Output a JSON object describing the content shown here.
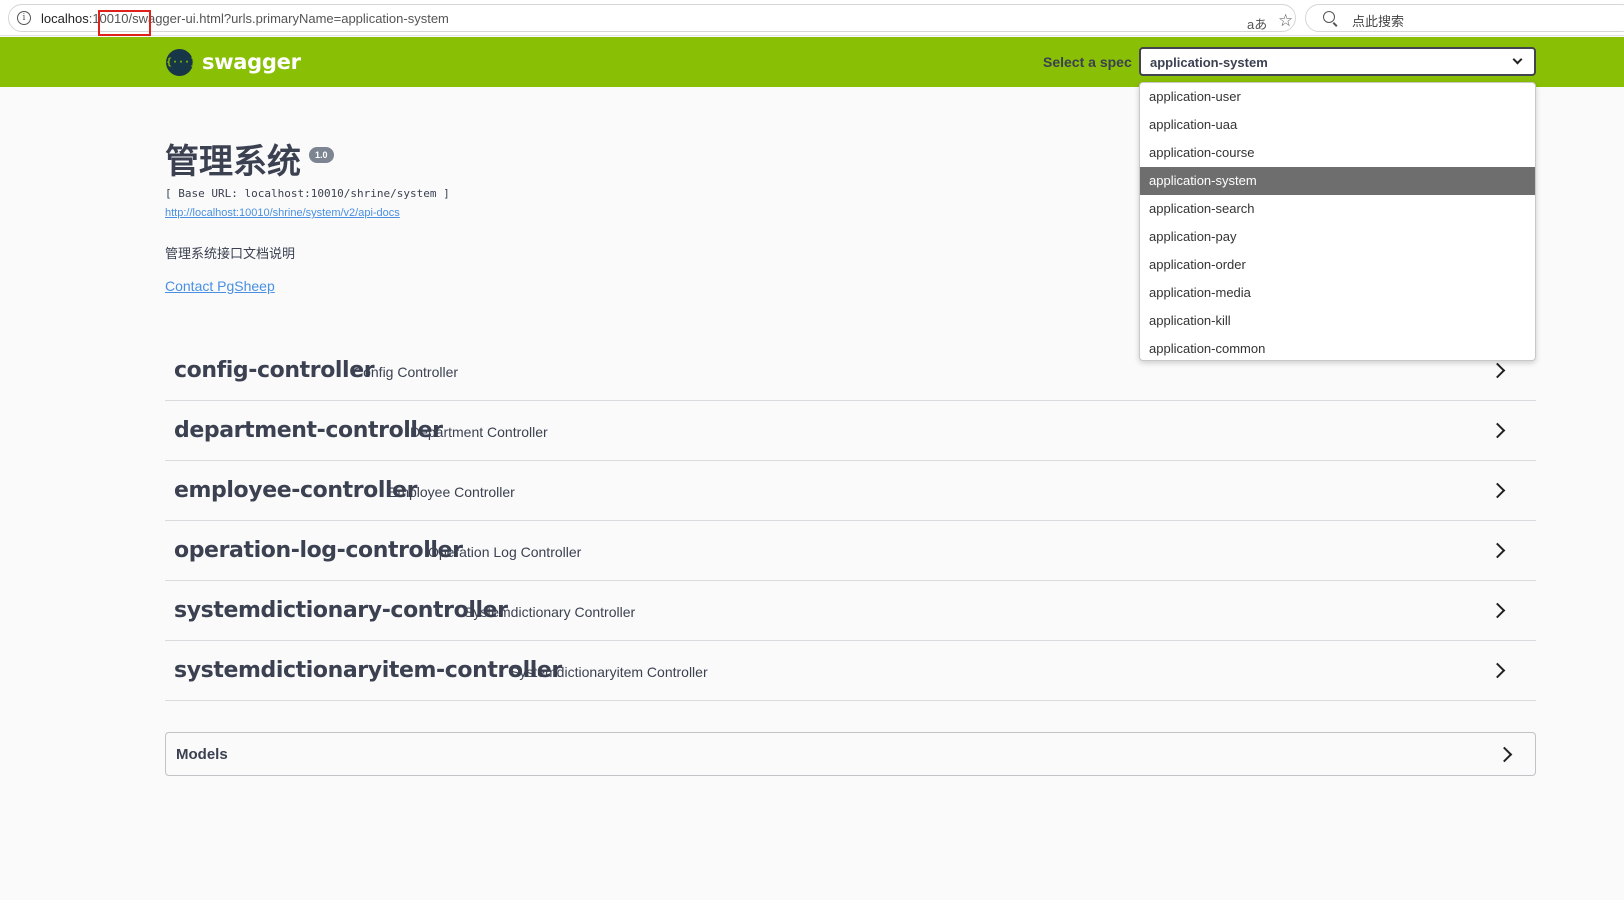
{
  "browser": {
    "url_host": "localhos",
    "url_port": ":10010/",
    "url_rest": "swagger-ui.html?urls.primaryName=application-system",
    "translate_icon": "aあ",
    "search_placeholder": "点此搜索"
  },
  "topbar": {
    "logo_text": "swagger",
    "logo_icon_glyph": "{···}",
    "select_label": "Select a spec",
    "selected_spec": "application-system",
    "brand_color": "#89bf04"
  },
  "spec_options": [
    "application-user",
    "application-uaa",
    "application-course",
    "application-system",
    "application-search",
    "application-pay",
    "application-order",
    "application-media",
    "application-kill",
    "application-common"
  ],
  "info": {
    "title": "管理系统",
    "version": "1.0",
    "base_url": "[ Base URL: localhost:10010/shrine/system ]",
    "api_docs_link": "http://localhost:10010/shrine/system/v2/api-docs",
    "description": "管理系统接口文档说明",
    "contact": "Contact PgSheep"
  },
  "controllers": [
    {
      "name": "config-controller",
      "desc": "Config Controller"
    },
    {
      "name": "department-controller",
      "desc": "Department Controller"
    },
    {
      "name": "employee-controller",
      "desc": "Employee Controller"
    },
    {
      "name": "operation-log-controller",
      "desc": "Operation Log Controller"
    },
    {
      "name": "systemdictionary-controller",
      "desc": "Systemdictionary Controller"
    },
    {
      "name": "systemdictionaryitem-controller",
      "desc": "Systemdictionaryitem Controller"
    }
  ],
  "models": {
    "label": "Models"
  }
}
